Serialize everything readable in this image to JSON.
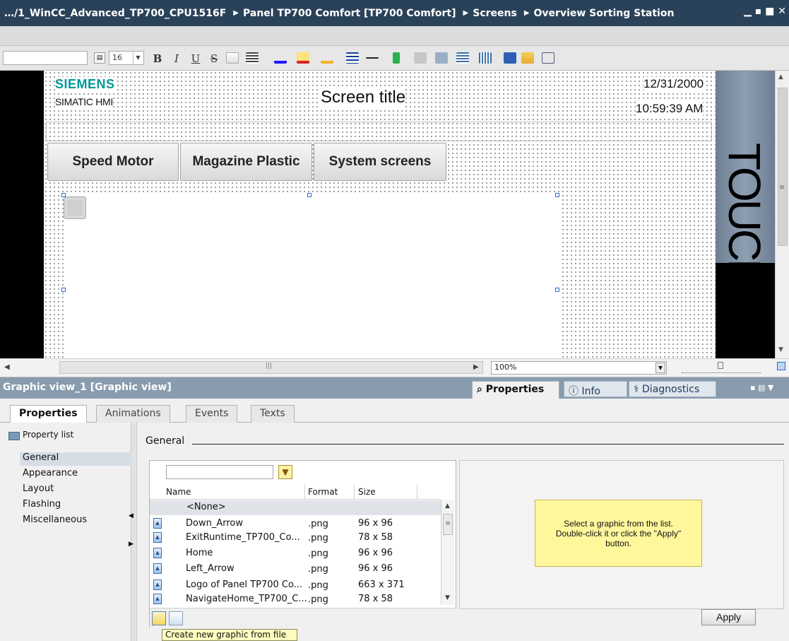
{
  "titlebar": {
    "crumbs": [
      "…/1_WinCC_Advanced_TP700_CPU1516F",
      "Panel TP700 Comfort [TP700 Comfort]",
      "Screens",
      "Overview Sorting Station"
    ],
    "separator": "▶",
    "win_controls": "▁ ▪ ■ ✕"
  },
  "format_toolbar": {
    "font_size": "16",
    "bold": "B",
    "italic": "I",
    "underline": "U",
    "strikethrough": "S"
  },
  "hmi_screen": {
    "brand": "SIEMENS",
    "product": "SIMATIC HMI",
    "title": "Screen title",
    "date": "12/31/2000",
    "time": "10:59:39 AM",
    "nav_buttons": [
      "Speed Motor",
      "Magazine Plastic",
      "System screens"
    ],
    "panel_label": "TOUCH"
  },
  "zoom": {
    "value": "100%"
  },
  "inspector": {
    "title": "Graphic view_1 [Graphic view]",
    "tabs": [
      "Properties",
      "Info",
      "Diagnostics"
    ],
    "subtabs": [
      "Properties",
      "Animations",
      "Events",
      "Texts"
    ],
    "property_list_label": "Property list",
    "nav_items": [
      "General",
      "Appearance",
      "Layout",
      "Flashing",
      "Miscellaneous"
    ],
    "section": "General"
  },
  "graphics_table": {
    "columns": [
      "Name",
      "Format",
      "Size"
    ],
    "rows": [
      {
        "name": "<None>",
        "format": "",
        "size": ""
      },
      {
        "name": "Down_Arrow",
        "format": ".png",
        "size": "96 x 96"
      },
      {
        "name": "ExitRuntime_TP700_Co...",
        "format": ".png",
        "size": "78 x 58"
      },
      {
        "name": "Home",
        "format": ".png",
        "size": "96 x 96"
      },
      {
        "name": "Left_Arrow",
        "format": ".png",
        "size": "96 x 96"
      },
      {
        "name": "Logo of Panel TP700 Co...",
        "format": ".png",
        "size": "663 x 371"
      },
      {
        "name": "NavigateHome_TP700_C...",
        "format": ".png",
        "size": "78 x 58"
      }
    ]
  },
  "preview": {
    "hint_line1": "Select a graphic from the list.",
    "hint_line2": "Double-click it or click the \"Apply\"",
    "hint_line3": "button."
  },
  "apply_label": "Apply",
  "tooltip": "Create new graphic from file",
  "colors": {
    "titlebar_bg": "#2a4259",
    "inspector_header_bg": "#889cae",
    "siemens_teal": "#009999",
    "hint_bg": "#fff79c"
  }
}
